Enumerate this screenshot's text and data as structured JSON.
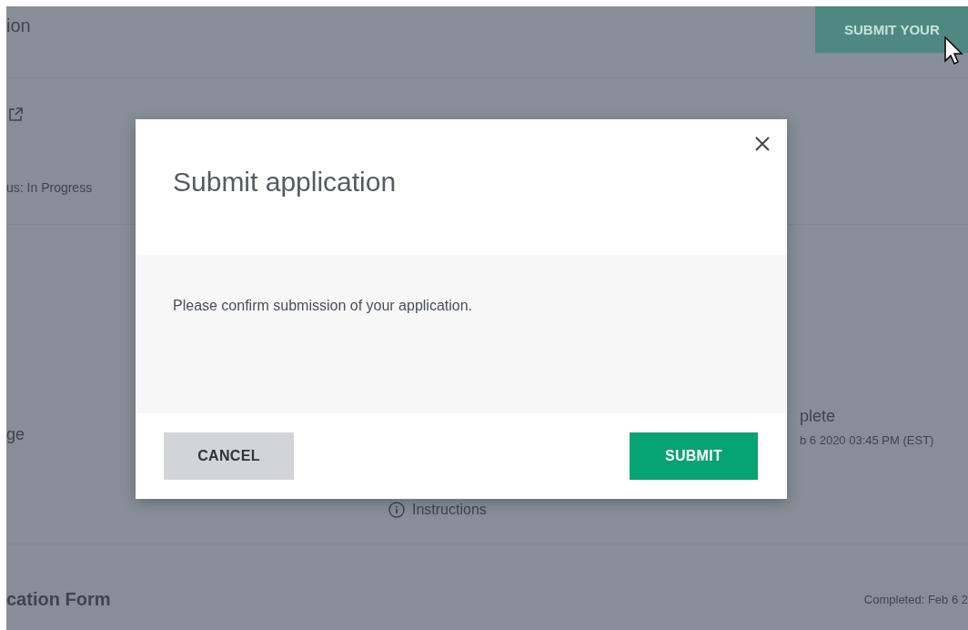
{
  "background_page": {
    "title": "ion",
    "action_button": "SUBMIT YOUR",
    "status": "us: In Progress",
    "task": {
      "label": "ge",
      "state": "plete",
      "date": "b 6 2020 03:45 PM (EST)",
      "link": "Instructions"
    },
    "form": {
      "label": "cation Form",
      "status": "Completed: Feb 6 2"
    }
  },
  "dialog": {
    "title": "Submit application",
    "message": "Please confirm submission of your application.",
    "buttons": [
      {
        "label": "CANCEL",
        "kind": "secondary"
      },
      {
        "label": "SUBMIT",
        "kind": "primary"
      }
    ]
  }
}
